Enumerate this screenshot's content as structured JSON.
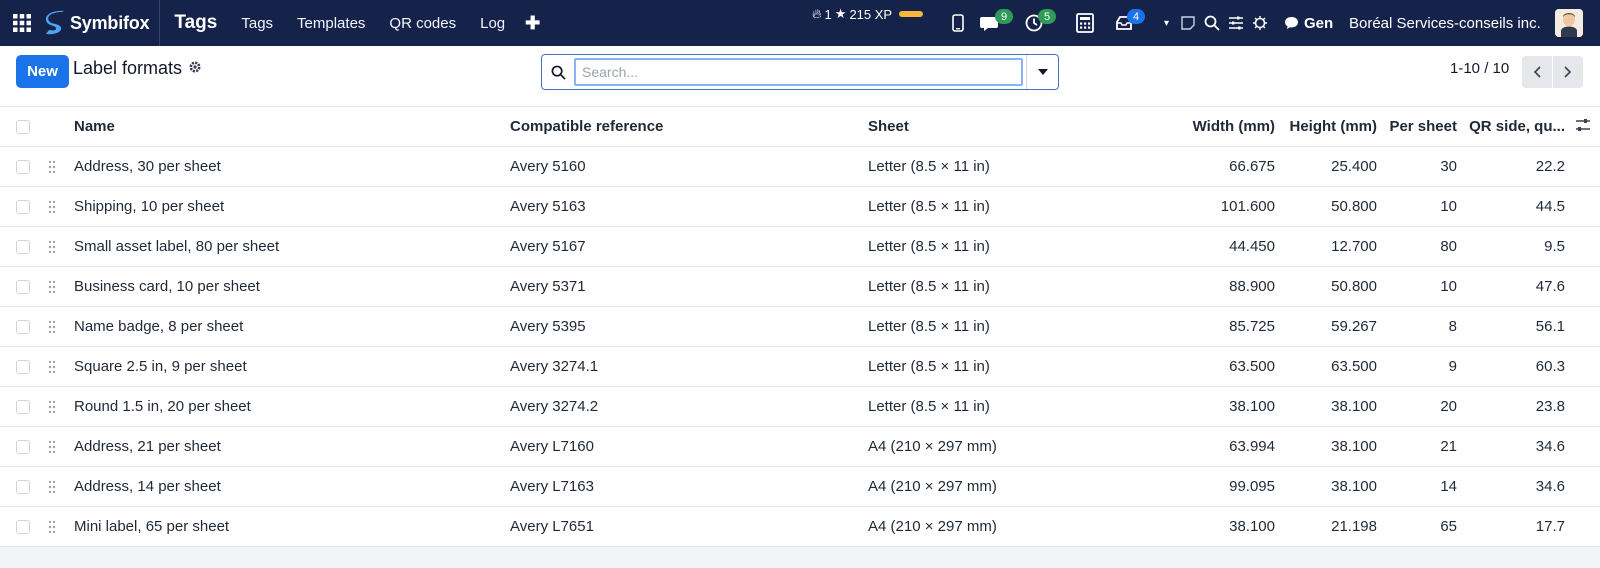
{
  "topbar": {
    "brand": "Symbifox",
    "app_title": "Tags",
    "menu": [
      "Tags",
      "Templates",
      "QR codes",
      "Log"
    ],
    "streak": "1",
    "xp": "215 XP",
    "badges": {
      "messages": "9",
      "activities": "5",
      "inbox": "4"
    },
    "gen_label": "Gen",
    "company": "Boréal Services-conseils inc.",
    "colors": {
      "bg": "#15224a",
      "badge_green": "#2e9b57",
      "badge_blue": "#1a73e8",
      "xp": "#f6b73c"
    }
  },
  "control": {
    "new_label": "New",
    "title": "Label formats",
    "search_placeholder": "Search...",
    "pager": "1-10 / 10"
  },
  "table": {
    "headers": {
      "name": "Name",
      "reference": "Compatible reference",
      "sheet": "Sheet",
      "width": "Width (mm)",
      "height": "Height (mm)",
      "per_sheet": "Per sheet",
      "qr_side": "QR side, qu..."
    },
    "rows": [
      {
        "name": "Address, 30 per sheet",
        "reference": "Avery 5160",
        "sheet": "Letter (8.5 × 11 in)",
        "width": "66.675",
        "height": "25.400",
        "per_sheet": "30",
        "qr_side": "22.2"
      },
      {
        "name": "Shipping, 10 per sheet",
        "reference": "Avery 5163",
        "sheet": "Letter (8.5 × 11 in)",
        "width": "101.600",
        "height": "50.800",
        "per_sheet": "10",
        "qr_side": "44.5"
      },
      {
        "name": "Small asset label, 80 per sheet",
        "reference": "Avery 5167",
        "sheet": "Letter (8.5 × 11 in)",
        "width": "44.450",
        "height": "12.700",
        "per_sheet": "80",
        "qr_side": "9.5"
      },
      {
        "name": "Business card, 10 per sheet",
        "reference": "Avery 5371",
        "sheet": "Letter (8.5 × 11 in)",
        "width": "88.900",
        "height": "50.800",
        "per_sheet": "10",
        "qr_side": "47.6"
      },
      {
        "name": "Name badge, 8 per sheet",
        "reference": "Avery 5395",
        "sheet": "Letter (8.5 × 11 in)",
        "width": "85.725",
        "height": "59.267",
        "per_sheet": "8",
        "qr_side": "56.1"
      },
      {
        "name": "Square 2.5 in, 9 per sheet",
        "reference": "Avery 3274.1",
        "sheet": "Letter (8.5 × 11 in)",
        "width": "63.500",
        "height": "63.500",
        "per_sheet": "9",
        "qr_side": "60.3"
      },
      {
        "name": "Round 1.5 in, 20 per sheet",
        "reference": "Avery 3274.2",
        "sheet": "Letter (8.5 × 11 in)",
        "width": "38.100",
        "height": "38.100",
        "per_sheet": "20",
        "qr_side": "23.8"
      },
      {
        "name": "Address, 21 per sheet",
        "reference": "Avery L7160",
        "sheet": "A4 (210 × 297 mm)",
        "width": "63.994",
        "height": "38.100",
        "per_sheet": "21",
        "qr_side": "34.6"
      },
      {
        "name": "Address, 14 per sheet",
        "reference": "Avery L7163",
        "sheet": "A4 (210 × 297 mm)",
        "width": "99.095",
        "height": "38.100",
        "per_sheet": "14",
        "qr_side": "34.6"
      },
      {
        "name": "Mini label, 65 per sheet",
        "reference": "Avery L7651",
        "sheet": "A4 (210 × 297 mm)",
        "width": "38.100",
        "height": "21.198",
        "per_sheet": "65",
        "qr_side": "17.7"
      }
    ]
  }
}
